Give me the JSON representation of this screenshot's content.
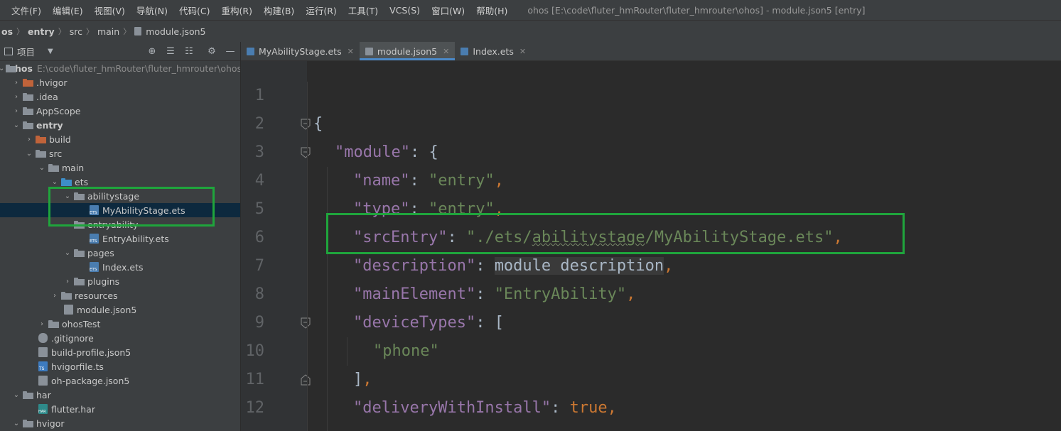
{
  "menu": [
    "文件(F)",
    "编辑(E)",
    "视图(V)",
    "导航(N)",
    "代码(C)",
    "重构(R)",
    "构建(B)",
    "运行(R)",
    "工具(T)",
    "VCS(S)",
    "窗口(W)",
    "帮助(H)"
  ],
  "window_title": "ohos [E:\\code\\fluter_hmRouter\\fluter_hmrouter\\ohos] - module.json5 [entry]",
  "breadcrumb": [
    "os",
    "entry",
    "src",
    "main",
    "module.json5"
  ],
  "project_panel": {
    "title": "项目",
    "tree": [
      {
        "label": "ohos",
        "path": "E:\\code\\fluter_hmRouter\\fluter_hmrouter\\ohos"
      },
      {
        "label": ".hvigor"
      },
      {
        "label": ".idea"
      },
      {
        "label": "AppScope"
      },
      {
        "label": "entry"
      },
      {
        "label": "build"
      },
      {
        "label": "src"
      },
      {
        "label": "main"
      },
      {
        "label": "ets"
      },
      {
        "label": "abilitystage"
      },
      {
        "label": "MyAbilityStage.ets"
      },
      {
        "label": "entryability"
      },
      {
        "label": "EntryAbility.ets"
      },
      {
        "label": "pages"
      },
      {
        "label": "Index.ets"
      },
      {
        "label": "plugins"
      },
      {
        "label": "resources"
      },
      {
        "label": "module.json5"
      },
      {
        "label": "ohosTest"
      },
      {
        "label": ".gitignore"
      },
      {
        "label": "build-profile.json5"
      },
      {
        "label": "hvigorfile.ts"
      },
      {
        "label": "oh-package.json5"
      },
      {
        "label": "har"
      },
      {
        "label": "flutter.har"
      },
      {
        "label": "hvigor"
      }
    ]
  },
  "tabs": [
    {
      "label": "MyAbilityStage.ets",
      "active": false
    },
    {
      "label": "module.json5",
      "active": true
    },
    {
      "label": "Index.ets",
      "active": false
    }
  ],
  "code": {
    "line_numbers": [
      "1",
      "2",
      "3",
      "4",
      "5",
      "6",
      "7",
      "8",
      "9",
      "10",
      "11",
      "12"
    ],
    "lines": [
      {
        "l1": "{"
      },
      {
        "k": "\"module\"",
        "c": ": ",
        "b": "{"
      },
      {
        "k": "\"name\"",
        "c": ": ",
        "v": "\"entry\"",
        "e": ","
      },
      {
        "k": "\"type\"",
        "c": ": ",
        "v": "\"entry\"",
        "e": ","
      },
      {
        "k": "\"srcEntry\"",
        "c": ": ",
        "v1": "\"./ets/",
        "v2": "abilitystage",
        "v3": "/MyAbilityStage.ets\"",
        "e": ","
      },
      {
        "k": "\"description\"",
        "c": ": ",
        "m": "module description",
        "e": ","
      },
      {
        "k": "\"mainElement\"",
        "c": ": ",
        "v": "\"EntryAbility\"",
        "e": ","
      },
      {
        "k": "\"deviceTypes\"",
        "c": ": ",
        "b": "["
      },
      {
        "v": "\"phone\""
      },
      {
        "b": "]",
        "e": ","
      },
      {
        "k": "\"deliveryWithInstall\"",
        "c": ": ",
        "t": "true",
        "e": ","
      }
    ]
  },
  "colors": {
    "highlight_box": "#1fa53c",
    "key": "#9876aa",
    "string": "#6a8759",
    "keyword": "#cc7832"
  }
}
